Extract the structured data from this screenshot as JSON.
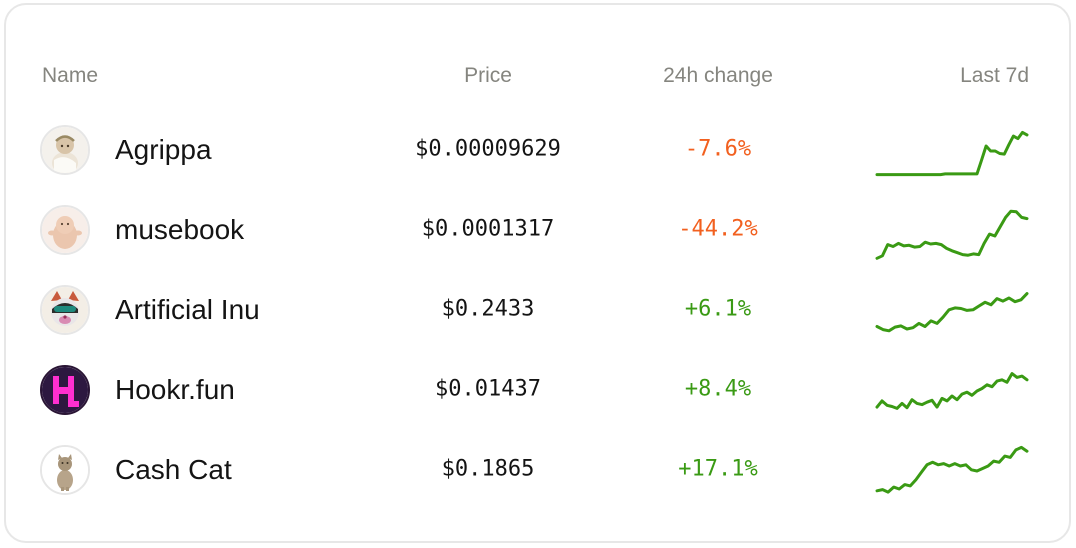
{
  "table": {
    "headers": {
      "name": "Name",
      "price": "Price",
      "change": "24h change",
      "last7d": "Last 7d"
    },
    "rows": [
      {
        "name": "Agrippa",
        "price": "$0.00009629",
        "change": "-7.6%",
        "trend": "down",
        "avatar_icon": "toga-figure-icon",
        "spark": [
          0.12,
          0.12,
          0.12,
          0.12,
          0.12,
          0.12,
          0.12,
          0.12,
          0.12,
          0.12,
          0.12,
          0.12,
          0.12,
          0.12,
          0.12,
          0.13,
          0.13,
          0.13,
          0.13,
          0.13,
          0.13,
          0.13,
          0.13,
          0.35,
          0.58,
          0.5,
          0.5,
          0.46,
          0.45,
          0.6,
          0.74,
          0.7,
          0.8,
          0.76
        ]
      },
      {
        "name": "musebook",
        "price": "$0.0001317",
        "change": "-44.2%",
        "trend": "down",
        "avatar_icon": "plush-creature-icon",
        "spark": [
          0.06,
          0.1,
          0.28,
          0.25,
          0.3,
          0.26,
          0.27,
          0.24,
          0.25,
          0.32,
          0.29,
          0.3,
          0.28,
          0.22,
          0.18,
          0.15,
          0.12,
          0.11,
          0.13,
          0.12,
          0.3,
          0.45,
          0.42,
          0.57,
          0.72,
          0.82,
          0.81,
          0.72,
          0.7
        ]
      },
      {
        "name": "Artificial Inu",
        "price": "$0.2433",
        "change": "+6.1%",
        "trend": "up",
        "avatar_icon": "cat-face-icon",
        "spark": [
          0.25,
          0.2,
          0.18,
          0.24,
          0.26,
          0.21,
          0.23,
          0.3,
          0.25,
          0.34,
          0.3,
          0.4,
          0.52,
          0.55,
          0.54,
          0.51,
          0.52,
          0.58,
          0.64,
          0.6,
          0.7,
          0.66,
          0.71,
          0.65,
          0.68,
          0.78
        ]
      },
      {
        "name": "Hookr.fun",
        "price": "$0.01437",
        "change": "+8.4%",
        "trend": "up",
        "avatar_icon": "letter-h-logo-icon",
        "spark": [
          0.24,
          0.34,
          0.27,
          0.25,
          0.22,
          0.3,
          0.23,
          0.36,
          0.3,
          0.28,
          0.32,
          0.35,
          0.24,
          0.38,
          0.34,
          0.42,
          0.36,
          0.45,
          0.48,
          0.43,
          0.5,
          0.54,
          0.6,
          0.57,
          0.66,
          0.68,
          0.64,
          0.78,
          0.72,
          0.74,
          0.68
        ]
      },
      {
        "name": "Cash Cat",
        "price": "$0.1865",
        "change": "+17.1%",
        "trend": "up",
        "avatar_icon": "cat-photo-icon",
        "spark": [
          0.18,
          0.2,
          0.16,
          0.24,
          0.21,
          0.28,
          0.26,
          0.36,
          0.48,
          0.6,
          0.64,
          0.6,
          0.62,
          0.58,
          0.62,
          0.58,
          0.6,
          0.52,
          0.5,
          0.54,
          0.58,
          0.66,
          0.64,
          0.74,
          0.72,
          0.84,
          0.88,
          0.82
        ]
      }
    ]
  },
  "colors": {
    "negative": "#f2601f",
    "positive": "#3a9a14",
    "sparkline": "#3a9a14",
    "header_text": "#85857f"
  }
}
